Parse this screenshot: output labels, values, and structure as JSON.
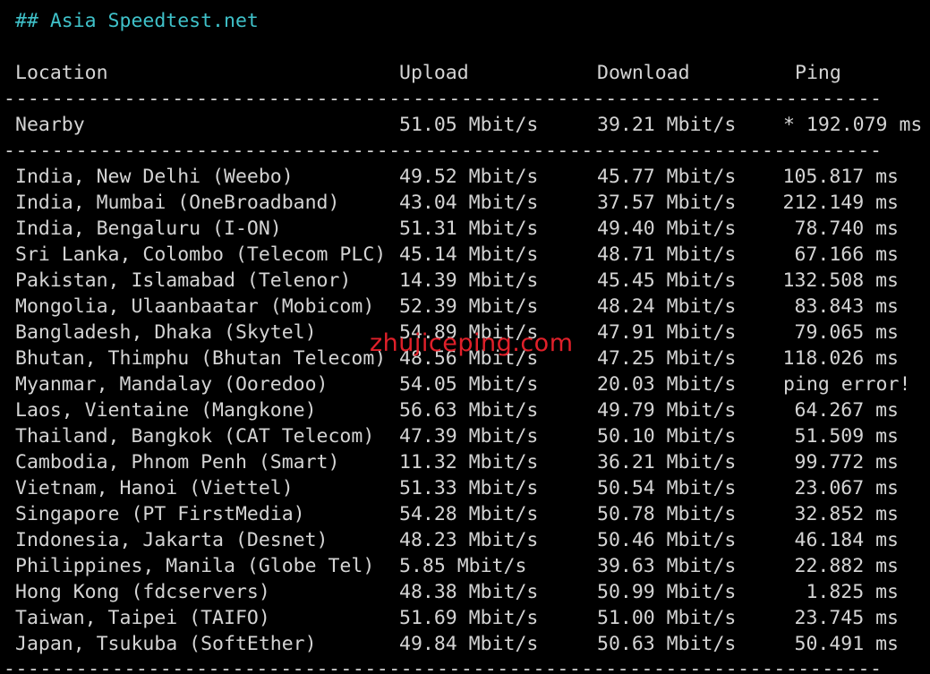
{
  "title": "## Asia Speedtest.net",
  "headers": {
    "location": "Location",
    "upload": "Upload",
    "download": "Download",
    "ping": "Ping"
  },
  "separator": "------------------------------------------------------------------------------------------------------------------------",
  "nearby": {
    "location": "Nearby",
    "upload": "51.05 Mbit/s",
    "download": "39.21 Mbit/s",
    "ping": "* 192.079 ms"
  },
  "rows": [
    {
      "location": "India, New Delhi (Weebo)",
      "upload": "49.52 Mbit/s",
      "download": "45.77 Mbit/s",
      "ping": "105.817 ms"
    },
    {
      "location": "India, Mumbai (OneBroadband)",
      "upload": "43.04 Mbit/s",
      "download": "37.57 Mbit/s",
      "ping": "212.149 ms"
    },
    {
      "location": "India, Bengaluru (I-ON)",
      "upload": "51.31 Mbit/s",
      "download": "49.40 Mbit/s",
      "ping": "78.740 ms"
    },
    {
      "location": "Sri Lanka, Colombo (Telecom PLC)",
      "upload": "45.14 Mbit/s",
      "download": "48.71 Mbit/s",
      "ping": "67.166 ms"
    },
    {
      "location": "Pakistan, Islamabad (Telenor)",
      "upload": "14.39 Mbit/s",
      "download": "45.45 Mbit/s",
      "ping": "132.508 ms"
    },
    {
      "location": "Mongolia, Ulaanbaatar (Mobicom)",
      "upload": "52.39 Mbit/s",
      "download": "48.24 Mbit/s",
      "ping": "83.843 ms"
    },
    {
      "location": "Bangladesh, Dhaka (Skytel)",
      "upload": "54.89 Mbit/s",
      "download": "47.91 Mbit/s",
      "ping": "79.065 ms"
    },
    {
      "location": "Bhutan, Thimphu (Bhutan Telecom)",
      "upload": "48.56 Mbit/s",
      "download": "47.25 Mbit/s",
      "ping": "118.026 ms"
    },
    {
      "location": "Myanmar, Mandalay (Ooredoo)",
      "upload": "54.05 Mbit/s",
      "download": "20.03 Mbit/s",
      "ping": "ping error!"
    },
    {
      "location": "Laos, Vientaine (Mangkone)",
      "upload": "56.63 Mbit/s",
      "download": "49.79 Mbit/s",
      "ping": "64.267 ms"
    },
    {
      "location": "Thailand, Bangkok (CAT Telecom)",
      "upload": "47.39 Mbit/s",
      "download": "50.10 Mbit/s",
      "ping": "51.509 ms"
    },
    {
      "location": "Cambodia, Phnom Penh (Smart)",
      "upload": "11.32 Mbit/s",
      "download": "36.21 Mbit/s",
      "ping": "99.772 ms"
    },
    {
      "location": "Vietnam, Hanoi (Viettel)",
      "upload": "51.33 Mbit/s",
      "download": "50.54 Mbit/s",
      "ping": "23.067 ms"
    },
    {
      "location": "Singapore (PT FirstMedia)",
      "upload": "54.28 Mbit/s",
      "download": "50.78 Mbit/s",
      "ping": "32.852 ms"
    },
    {
      "location": "Indonesia, Jakarta (Desnet)",
      "upload": "48.23 Mbit/s",
      "download": "50.46 Mbit/s",
      "ping": "46.184 ms"
    },
    {
      "location": "Philippines, Manila (Globe Tel)",
      "upload": "5.85 Mbit/s",
      "download": "39.63 Mbit/s",
      "ping": "22.882 ms"
    },
    {
      "location": "Hong Kong (fdcservers)",
      "upload": "48.38 Mbit/s",
      "download": "50.99 Mbit/s",
      "ping": "1.825 ms"
    },
    {
      "location": "Taiwan, Taipei (TAIFO)",
      "upload": "51.69 Mbit/s",
      "download": "51.00 Mbit/s",
      "ping": "23.745 ms"
    },
    {
      "location": "Japan, Tsukuba (SoftEther)",
      "upload": "49.84 Mbit/s",
      "download": "50.63 Mbit/s",
      "ping": "50.491 ms"
    }
  ],
  "watermark": "zhujiceping.com",
  "colors": {
    "background": "#000000",
    "text": "#d4d4d4",
    "title": "#3fc1c9",
    "watermark": "#e0202a"
  }
}
